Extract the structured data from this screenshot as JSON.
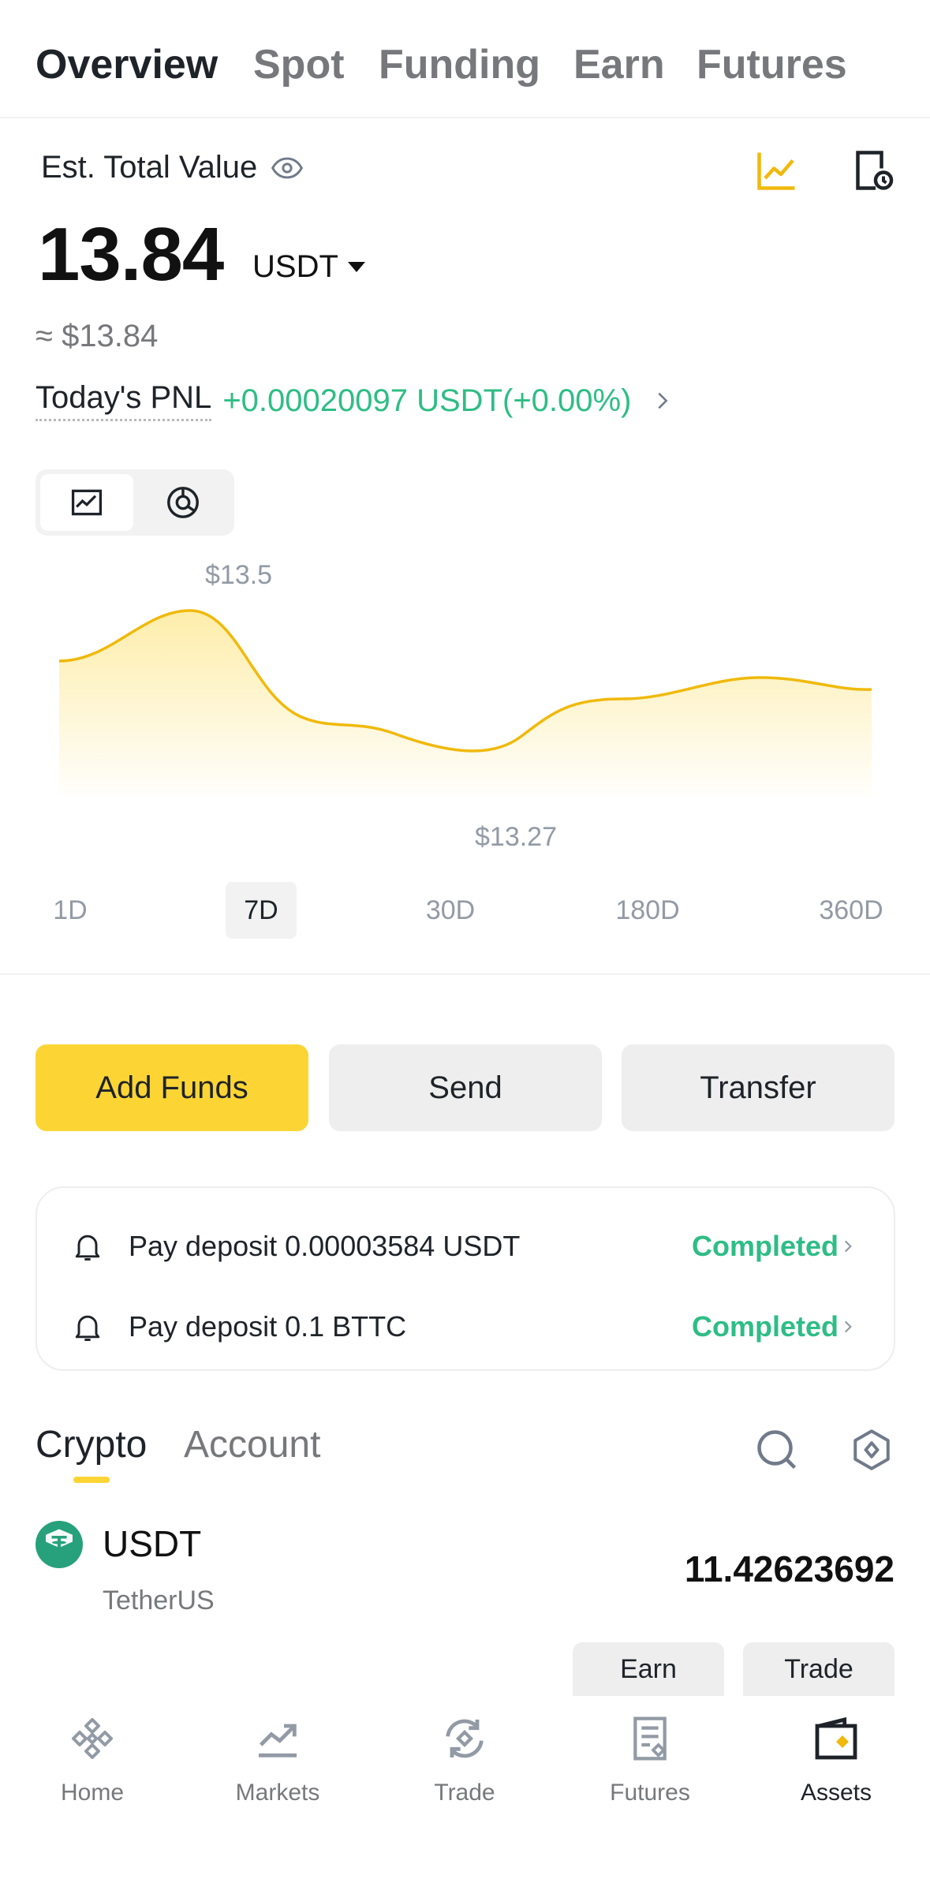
{
  "top_tabs": [
    "Overview",
    "Spot",
    "Funding",
    "Earn",
    "Futures"
  ],
  "header": {
    "est_label": "Est. Total Value",
    "balance": "13.84",
    "currency": "USDT",
    "approx": "≈ $13.84",
    "pnl_label": "Today's PNL",
    "pnl_value": "+0.00020097 USDT(+0.00%)"
  },
  "chart": {
    "max_label": "$13.5",
    "min_label": "$13.27",
    "ranges": [
      "1D",
      "7D",
      "30D",
      "180D",
      "360D"
    ],
    "active_range": "7D"
  },
  "actions": {
    "add_funds": "Add Funds",
    "send": "Send",
    "transfer": "Transfer"
  },
  "notices": [
    {
      "text": "Pay deposit 0.00003584 USDT",
      "status": "Completed"
    },
    {
      "text": "Pay deposit 0.1 BTTC",
      "status": "Completed"
    }
  ],
  "sub_tabs": {
    "crypto": "Crypto",
    "account": "Account"
  },
  "asset": {
    "symbol": "USDT",
    "name": "TetherUS",
    "amount": "11.42623692",
    "earn": "Earn",
    "trade": "Trade"
  },
  "bottom_nav": [
    "Home",
    "Markets",
    "Trade",
    "Futures",
    "Assets"
  ],
  "colors": {
    "accent": "#fcd535",
    "positive": "#2ebd85",
    "chart_line": "#f0b90b"
  }
}
